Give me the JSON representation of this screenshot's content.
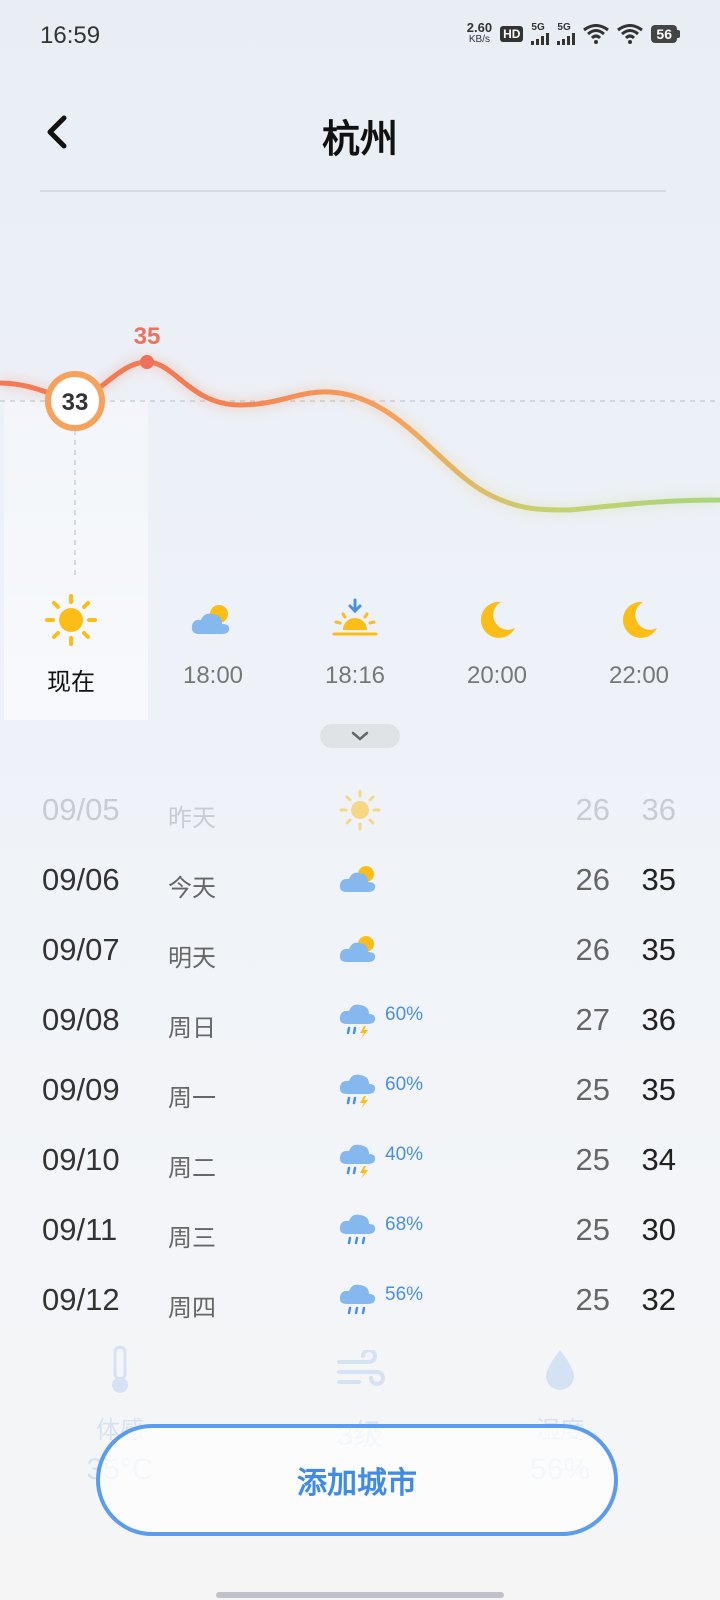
{
  "status_bar": {
    "time": "16:59",
    "net_speed_value": "2.60",
    "net_speed_unit": "KB/s",
    "hd_label": "HD",
    "hd_sub": "1 2",
    "sim1": "5G",
    "sim2": "5G",
    "battery": "56"
  },
  "header": {
    "back_icon": "chevron-left-icon",
    "title": "杭州"
  },
  "hourly_chart": {
    "current_temp": "33",
    "peak_temp": "35",
    "colors": {
      "warm": "#f47a55",
      "mid": "#f5a05a",
      "cool": "#a9d47e"
    }
  },
  "hourly": [
    {
      "label": "现在",
      "icon": "sun-icon"
    },
    {
      "label": "18:00",
      "icon": "partly-cloudy-icon"
    },
    {
      "label": "18:16",
      "icon": "sunset-icon"
    },
    {
      "label": "20:00",
      "icon": "moon-icon"
    },
    {
      "label": "22:00",
      "icon": "moon-icon"
    }
  ],
  "daily": [
    {
      "date": "09/05",
      "name": "昨天",
      "icon": "sun-icon",
      "prob": "",
      "low": "26",
      "high": "36"
    },
    {
      "date": "09/06",
      "name": "今天",
      "icon": "partly-cloudy-icon",
      "prob": "",
      "low": "26",
      "high": "35"
    },
    {
      "date": "09/07",
      "name": "明天",
      "icon": "partly-cloudy-icon",
      "prob": "",
      "low": "26",
      "high": "35"
    },
    {
      "date": "09/08",
      "name": "周日",
      "icon": "thunderstorm-icon",
      "prob": "60%",
      "low": "27",
      "high": "36"
    },
    {
      "date": "09/09",
      "name": "周一",
      "icon": "thunderstorm-icon",
      "prob": "60%",
      "low": "25",
      "high": "35"
    },
    {
      "date": "09/10",
      "name": "周二",
      "icon": "thunderstorm-icon",
      "prob": "40%",
      "low": "25",
      "high": "34"
    },
    {
      "date": "09/11",
      "name": "周三",
      "icon": "rain-icon",
      "prob": "68%",
      "low": "25",
      "high": "30"
    },
    {
      "date": "09/12",
      "name": "周四",
      "icon": "rain-icon",
      "prob": "56%",
      "low": "25",
      "high": "32"
    }
  ],
  "details": [
    {
      "icon": "thermometer-icon",
      "label": "体感",
      "value": "35°C"
    },
    {
      "icon": "wind-icon",
      "label": "",
      "value": "3级"
    },
    {
      "icon": "humidity-icon",
      "label": "湿度",
      "value": "56%"
    }
  ],
  "add_city_button": "添加城市"
}
